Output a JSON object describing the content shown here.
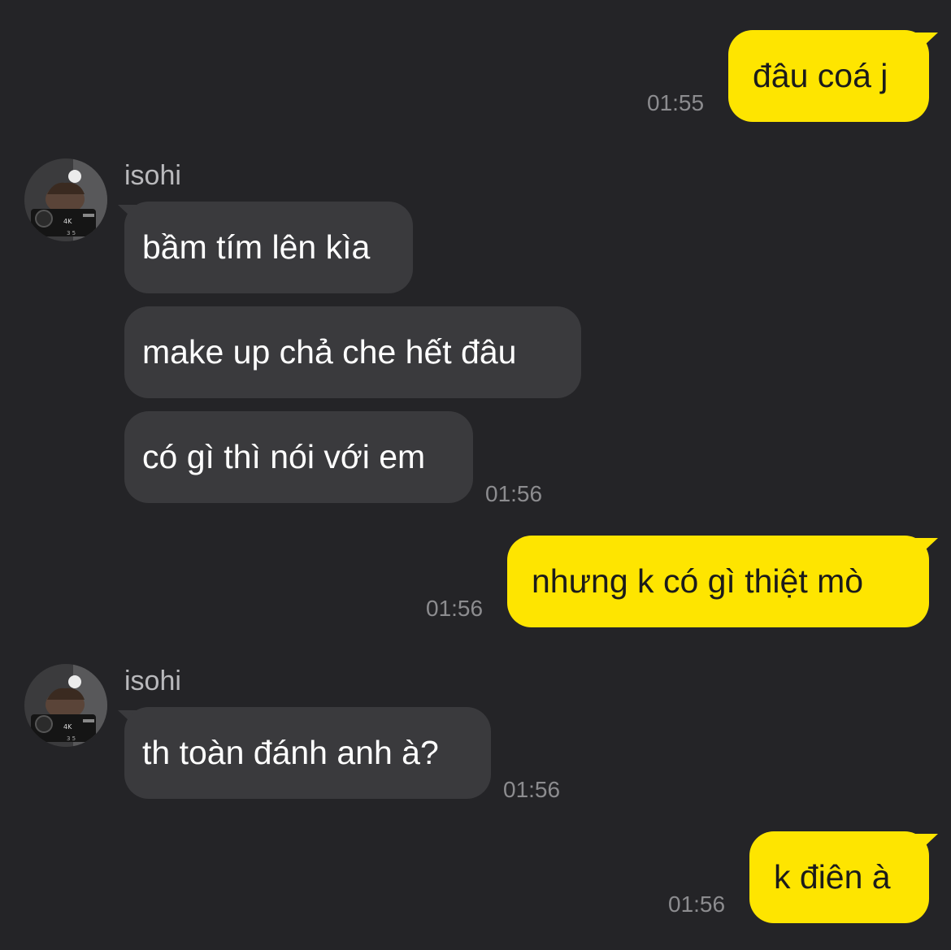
{
  "colors": {
    "background": "#242427",
    "mine_bubble": "#FEE500",
    "their_bubble": "#3A3A3D",
    "timestamp": "#8C8C8F"
  },
  "messages": [
    {
      "side": "mine",
      "text": "đâu coá j",
      "time": "01:55"
    },
    {
      "side": "theirs",
      "sender": "isohi",
      "avatar": "profile-photo",
      "lines": [
        {
          "text": "bầm tím lên kìa"
        },
        {
          "text": "make up chả che hết đâu"
        },
        {
          "text": "có gì thì nói với em",
          "time": "01:56"
        }
      ]
    },
    {
      "side": "mine",
      "text": "nhưng k có gì thiệt mò",
      "time": "01:56"
    },
    {
      "side": "theirs",
      "sender": "isohi",
      "avatar": "profile-photo",
      "lines": [
        {
          "text": "th toàn đánh anh à?",
          "time": "01:56"
        }
      ]
    },
    {
      "side": "mine",
      "text": "k điên à",
      "time": "01:56"
    }
  ]
}
